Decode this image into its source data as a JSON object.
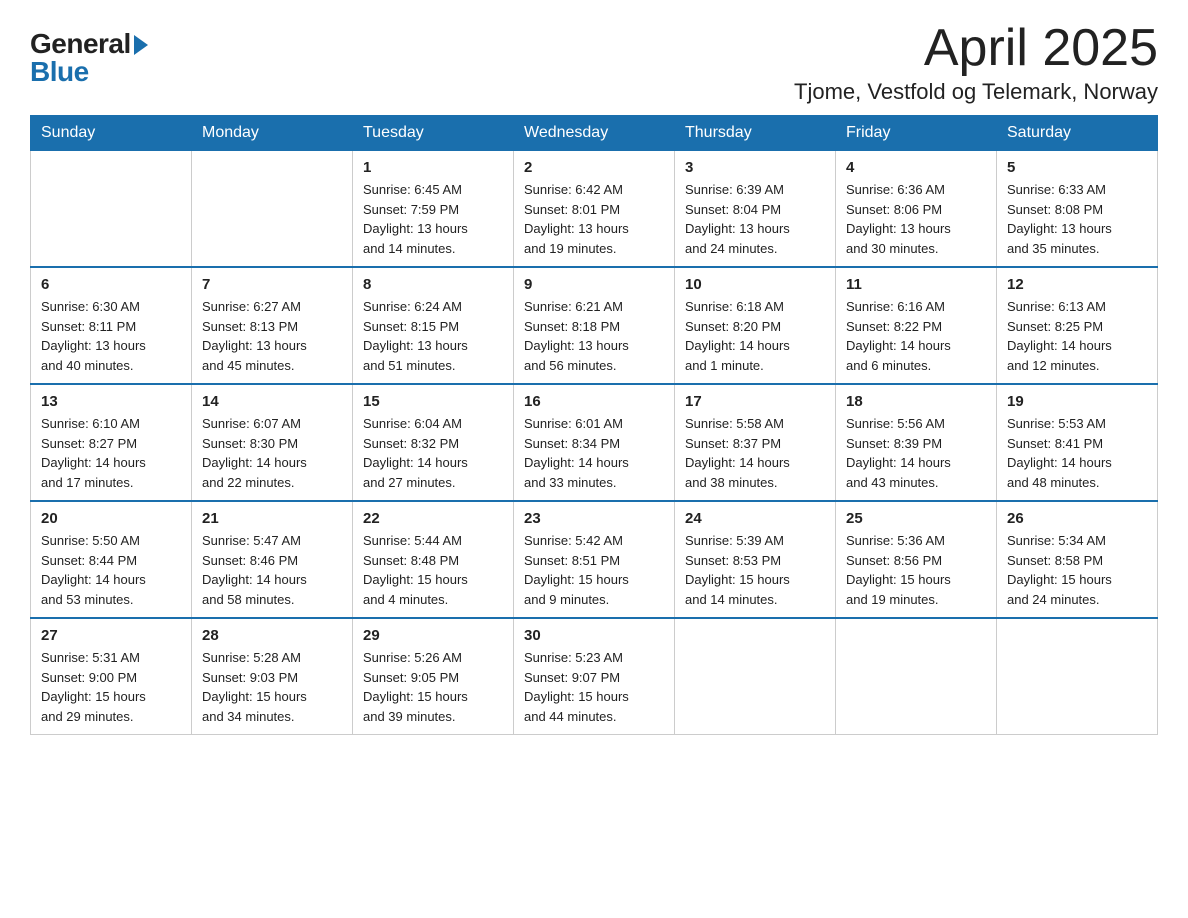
{
  "logo": {
    "general": "General",
    "blue": "Blue"
  },
  "header": {
    "month_year": "April 2025",
    "location": "Tjome, Vestfold og Telemark, Norway"
  },
  "days_of_week": [
    "Sunday",
    "Monday",
    "Tuesday",
    "Wednesday",
    "Thursday",
    "Friday",
    "Saturday"
  ],
  "weeks": [
    [
      {
        "day": "",
        "detail": ""
      },
      {
        "day": "",
        "detail": ""
      },
      {
        "day": "1",
        "detail": "Sunrise: 6:45 AM\nSunset: 7:59 PM\nDaylight: 13 hours\nand 14 minutes."
      },
      {
        "day": "2",
        "detail": "Sunrise: 6:42 AM\nSunset: 8:01 PM\nDaylight: 13 hours\nand 19 minutes."
      },
      {
        "day": "3",
        "detail": "Sunrise: 6:39 AM\nSunset: 8:04 PM\nDaylight: 13 hours\nand 24 minutes."
      },
      {
        "day": "4",
        "detail": "Sunrise: 6:36 AM\nSunset: 8:06 PM\nDaylight: 13 hours\nand 30 minutes."
      },
      {
        "day": "5",
        "detail": "Sunrise: 6:33 AM\nSunset: 8:08 PM\nDaylight: 13 hours\nand 35 minutes."
      }
    ],
    [
      {
        "day": "6",
        "detail": "Sunrise: 6:30 AM\nSunset: 8:11 PM\nDaylight: 13 hours\nand 40 minutes."
      },
      {
        "day": "7",
        "detail": "Sunrise: 6:27 AM\nSunset: 8:13 PM\nDaylight: 13 hours\nand 45 minutes."
      },
      {
        "day": "8",
        "detail": "Sunrise: 6:24 AM\nSunset: 8:15 PM\nDaylight: 13 hours\nand 51 minutes."
      },
      {
        "day": "9",
        "detail": "Sunrise: 6:21 AM\nSunset: 8:18 PM\nDaylight: 13 hours\nand 56 minutes."
      },
      {
        "day": "10",
        "detail": "Sunrise: 6:18 AM\nSunset: 8:20 PM\nDaylight: 14 hours\nand 1 minute."
      },
      {
        "day": "11",
        "detail": "Sunrise: 6:16 AM\nSunset: 8:22 PM\nDaylight: 14 hours\nand 6 minutes."
      },
      {
        "day": "12",
        "detail": "Sunrise: 6:13 AM\nSunset: 8:25 PM\nDaylight: 14 hours\nand 12 minutes."
      }
    ],
    [
      {
        "day": "13",
        "detail": "Sunrise: 6:10 AM\nSunset: 8:27 PM\nDaylight: 14 hours\nand 17 minutes."
      },
      {
        "day": "14",
        "detail": "Sunrise: 6:07 AM\nSunset: 8:30 PM\nDaylight: 14 hours\nand 22 minutes."
      },
      {
        "day": "15",
        "detail": "Sunrise: 6:04 AM\nSunset: 8:32 PM\nDaylight: 14 hours\nand 27 minutes."
      },
      {
        "day": "16",
        "detail": "Sunrise: 6:01 AM\nSunset: 8:34 PM\nDaylight: 14 hours\nand 33 minutes."
      },
      {
        "day": "17",
        "detail": "Sunrise: 5:58 AM\nSunset: 8:37 PM\nDaylight: 14 hours\nand 38 minutes."
      },
      {
        "day": "18",
        "detail": "Sunrise: 5:56 AM\nSunset: 8:39 PM\nDaylight: 14 hours\nand 43 minutes."
      },
      {
        "day": "19",
        "detail": "Sunrise: 5:53 AM\nSunset: 8:41 PM\nDaylight: 14 hours\nand 48 minutes."
      }
    ],
    [
      {
        "day": "20",
        "detail": "Sunrise: 5:50 AM\nSunset: 8:44 PM\nDaylight: 14 hours\nand 53 minutes."
      },
      {
        "day": "21",
        "detail": "Sunrise: 5:47 AM\nSunset: 8:46 PM\nDaylight: 14 hours\nand 58 minutes."
      },
      {
        "day": "22",
        "detail": "Sunrise: 5:44 AM\nSunset: 8:48 PM\nDaylight: 15 hours\nand 4 minutes."
      },
      {
        "day": "23",
        "detail": "Sunrise: 5:42 AM\nSunset: 8:51 PM\nDaylight: 15 hours\nand 9 minutes."
      },
      {
        "day": "24",
        "detail": "Sunrise: 5:39 AM\nSunset: 8:53 PM\nDaylight: 15 hours\nand 14 minutes."
      },
      {
        "day": "25",
        "detail": "Sunrise: 5:36 AM\nSunset: 8:56 PM\nDaylight: 15 hours\nand 19 minutes."
      },
      {
        "day": "26",
        "detail": "Sunrise: 5:34 AM\nSunset: 8:58 PM\nDaylight: 15 hours\nand 24 minutes."
      }
    ],
    [
      {
        "day": "27",
        "detail": "Sunrise: 5:31 AM\nSunset: 9:00 PM\nDaylight: 15 hours\nand 29 minutes."
      },
      {
        "day": "28",
        "detail": "Sunrise: 5:28 AM\nSunset: 9:03 PM\nDaylight: 15 hours\nand 34 minutes."
      },
      {
        "day": "29",
        "detail": "Sunrise: 5:26 AM\nSunset: 9:05 PM\nDaylight: 15 hours\nand 39 minutes."
      },
      {
        "day": "30",
        "detail": "Sunrise: 5:23 AM\nSunset: 9:07 PM\nDaylight: 15 hours\nand 44 minutes."
      },
      {
        "day": "",
        "detail": ""
      },
      {
        "day": "",
        "detail": ""
      },
      {
        "day": "",
        "detail": ""
      }
    ]
  ]
}
